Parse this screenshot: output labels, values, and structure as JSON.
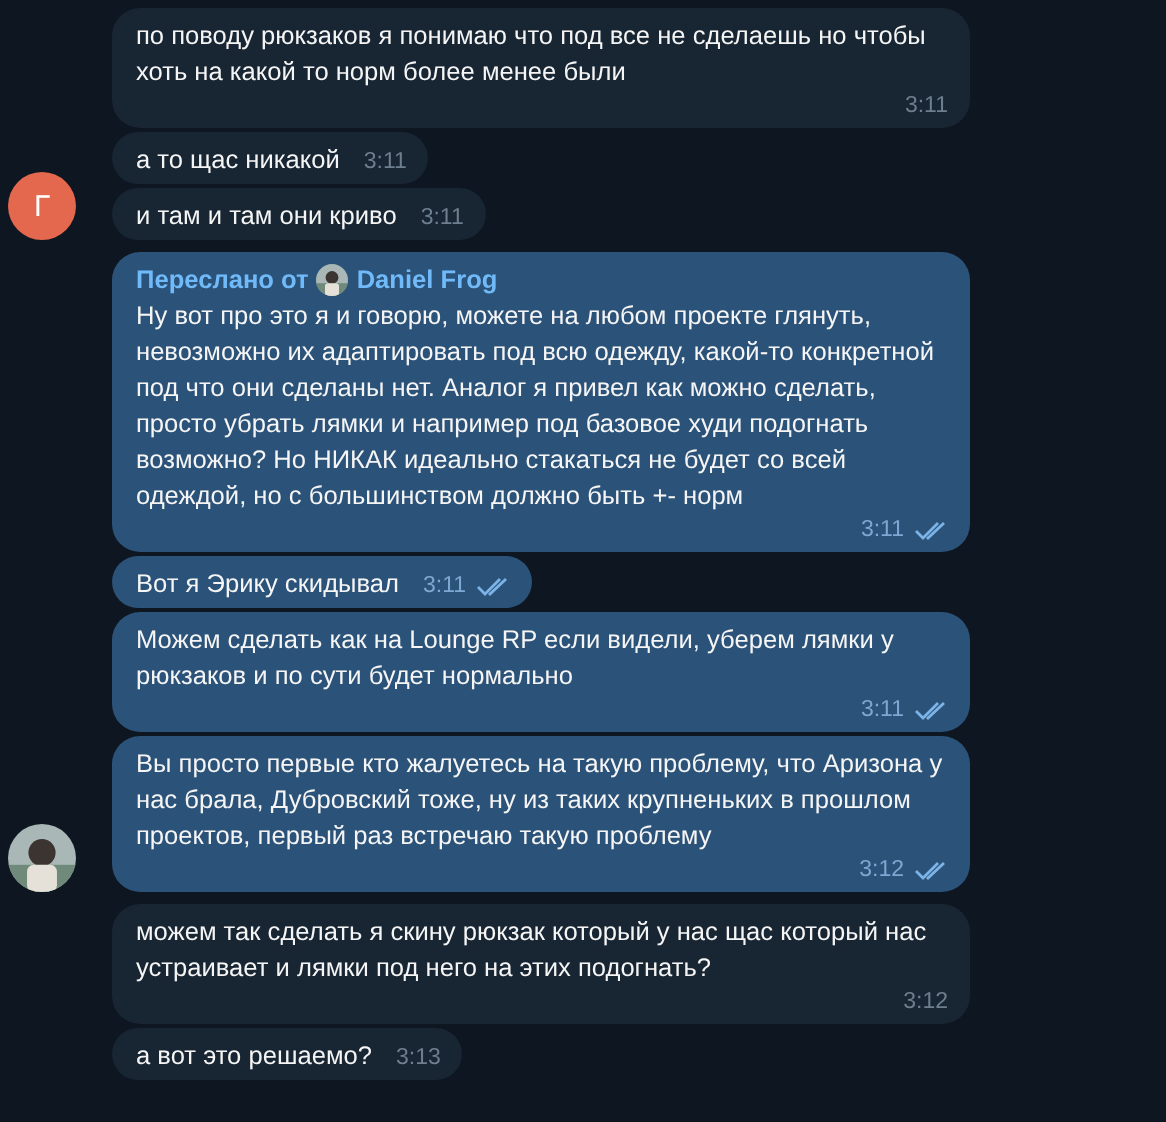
{
  "groups": [
    {
      "kind": "incoming",
      "avatar": {
        "kind": "letter",
        "letter": "Г",
        "color": "#e4684e"
      },
      "messages": [
        {
          "text": "по поводу рюкзаков я понимаю что под все не сделаешь но чтобы хоть на какой то норм более менее были",
          "time": "3:11"
        },
        {
          "text": "а то щас никакой",
          "time": "3:11"
        },
        {
          "text": "и там и там они криво",
          "time": "3:11"
        }
      ]
    },
    {
      "kind": "outgoing",
      "messages": [
        {
          "forwarded": {
            "label": "Переслано от",
            "name": "Daniel Frog"
          },
          "text": "Ну вот про это я и говорю, можете на любом проекте глянуть, невозможно их адаптировать под всю одежду, какой-то конкретной под что они сделаны нет. Аналог я привел как можно сделать, просто убрать лямки и например под базовое худи подогнать возможно? Но НИКАК идеально стакаться не будет со всей одеждой, но с большинством должно быть +- норм",
          "time": "3:11",
          "read": true
        },
        {
          "text": "Вот я Эрику скидывал",
          "time": "3:11",
          "read": true
        },
        {
          "text": "Можем сделать как на Lounge RP если видели, уберем лямки у рюкзаков и по сути будет нормально",
          "time": "3:11",
          "read": true
        },
        {
          "text": "Вы просто первые кто жалуетесь на такую проблему, что Аризона у нас брала, Дубровский тоже, ну из таких крупненьких в прошлом проектов, первый раз встречаю такую проблему",
          "time": "3:12",
          "read": true
        }
      ]
    },
    {
      "kind": "incoming",
      "messages": [
        {
          "text": "можем так сделать я скину рюкзак который у нас щас который нас устраивает и лямки под него на этих подогнать?",
          "time": "3:12"
        },
        {
          "text": "а вот это решаемо?",
          "time": "3:13"
        }
      ]
    }
  ]
}
